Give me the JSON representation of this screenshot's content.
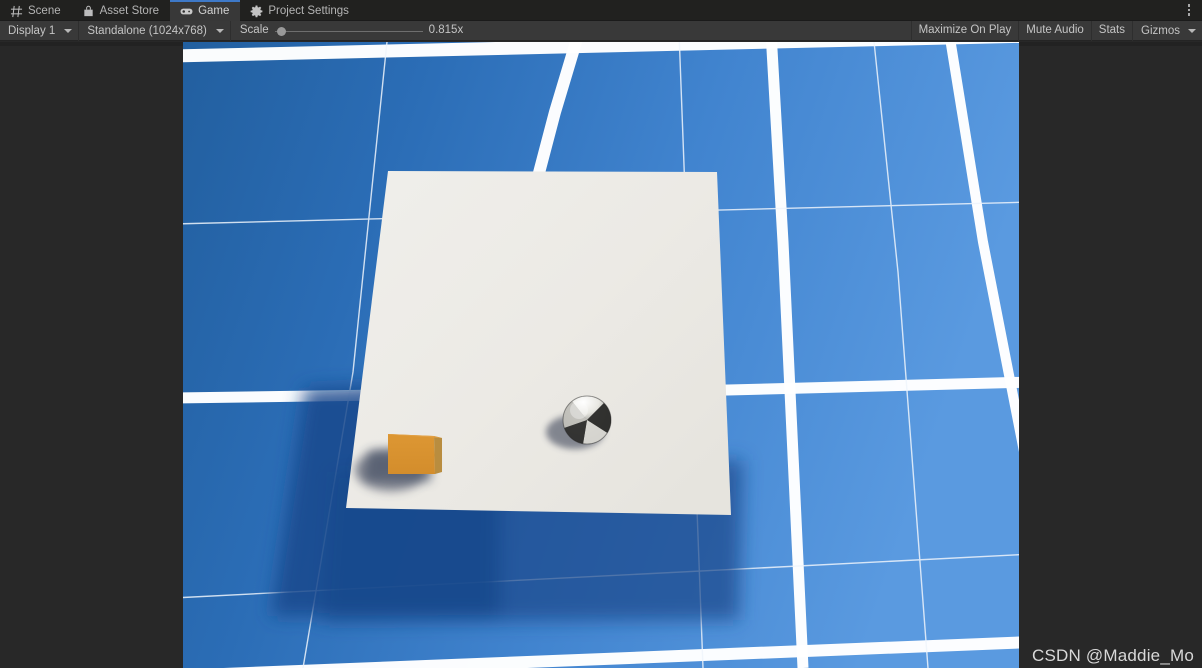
{
  "window": {
    "editor": "Unity Editor",
    "overflow_menu_icon": "kebab-menu-icon"
  },
  "tabs": [
    {
      "label": "Scene",
      "icon": "grid-icon",
      "active": false
    },
    {
      "label": "Asset Store",
      "icon": "store-icon",
      "active": false
    },
    {
      "label": "Game",
      "icon": "gamepad-icon",
      "active": true
    },
    {
      "label": "Project Settings",
      "icon": "gear-icon",
      "active": false
    }
  ],
  "toolbar": {
    "display_selector": {
      "name": "display-dropdown",
      "value": "Display 1",
      "caret_icon": "chevron-down-icon"
    },
    "aspect_selector": {
      "name": "aspect-dropdown",
      "value": "Standalone (1024x768)",
      "caret_icon": "chevron-down-icon"
    },
    "scale": {
      "label": "Scale",
      "value_text": "0.815x",
      "value": 0.815,
      "min": 0.1,
      "max": 6.0,
      "thumb_position_pct": 2
    },
    "maximize_on_play": "Maximize On Play",
    "mute_audio": "Mute Audio",
    "stats": "Stats",
    "gizmos": "Gizmos",
    "gizmos_caret_icon": "chevron-down-icon"
  },
  "gameview": {
    "label": "game-viewport",
    "resolution": "1024x768",
    "render_scale": "0.815x",
    "letterbox_color": "#282828",
    "scene": {
      "floor_color_left": "#2669b5",
      "floor_color_right": "#5a9ae0",
      "grid_line_color": "#ffffff",
      "plane_color": "#eceae5",
      "plane_shadow_color": "#1e4f92",
      "cube_color": "#d9912f",
      "cube_side_color": "#b88b3e",
      "sphere_light_color": "#f2f1ec",
      "sphere_dark_color": "#3a3a38",
      "object_shadow_color": "#3a4358"
    }
  },
  "watermark": {
    "text": "CSDN @Maddie_Mo"
  }
}
